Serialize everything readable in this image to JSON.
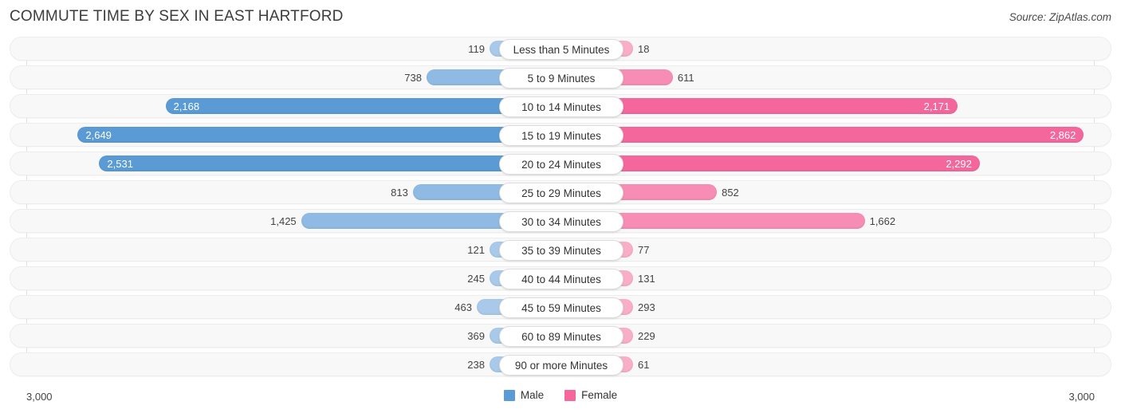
{
  "header": {
    "title": "COMMUTE TIME BY SEX IN EAST HARTFORD",
    "source": "Source: ZipAtlas.com"
  },
  "axis": {
    "left_label": "3,000",
    "right_label": "3,000"
  },
  "legend": {
    "items": [
      {
        "label": "Male",
        "color": "#5b9bd5"
      },
      {
        "label": "Female",
        "color": "#f4679d"
      }
    ]
  },
  "colors": {
    "male_strong": "#5b9bd5",
    "male_mid": "#8ebae4",
    "male_light": "#a8c9ea",
    "female_strong": "#f4679d",
    "female_mid": "#f78cb4",
    "female_light": "#f9aec8",
    "row_background": "#f8f8f8",
    "row_border": "#ededed",
    "gridline": "#e3e3e3"
  },
  "chart_data": {
    "type": "bar",
    "title": "COMMUTE TIME BY SEX IN EAST HARTFORD",
    "subtitle": "",
    "orientation": "horizontal-diverging",
    "xlabel": "",
    "ylabel": "",
    "xlim": [
      -3000,
      3000
    ],
    "axis_max": 3000,
    "grid": true,
    "legend_position": "bottom-center",
    "categories": [
      "Less than 5 Minutes",
      "5 to 9 Minutes",
      "10 to 14 Minutes",
      "15 to 19 Minutes",
      "20 to 24 Minutes",
      "25 to 29 Minutes",
      "30 to 34 Minutes",
      "35 to 39 Minutes",
      "40 to 44 Minutes",
      "45 to 59 Minutes",
      "60 to 89 Minutes",
      "90 or more Minutes"
    ],
    "series": [
      {
        "name": "Male",
        "values": [
          119,
          738,
          2168,
          2649,
          2531,
          813,
          1425,
          121,
          245,
          463,
          369,
          238
        ],
        "labels": [
          "119",
          "738",
          "2,168",
          "2,649",
          "2,531",
          "813",
          "1,425",
          "121",
          "245",
          "463",
          "369",
          "238"
        ]
      },
      {
        "name": "Female",
        "values": [
          18,
          611,
          2171,
          2862,
          2292,
          852,
          1662,
          77,
          131,
          293,
          229,
          61
        ],
        "labels": [
          "18",
          "611",
          "2,171",
          "2,862",
          "2,292",
          "852",
          "1,662",
          "77",
          "131",
          "293",
          "229",
          "61"
        ]
      }
    ]
  }
}
